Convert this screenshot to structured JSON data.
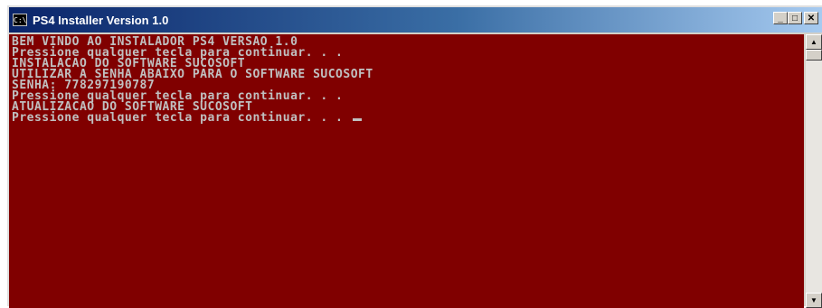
{
  "window": {
    "title": "PS4 Installer Version 1.0",
    "icon_text": "C:\\",
    "buttons": {
      "minimize": "_",
      "maximize": "□",
      "close": "✕"
    }
  },
  "console": {
    "lines": [
      "BEM VINDO AO INSTALADOR PS4 VERSAO 1.0",
      "Pressione qualquer tecla para continuar. . .",
      "INSTALACAO DO SOFTWARE SUCOSOFT",
      "UTILIZAR A SENHA ABAIXO PARA O SOFTWARE SUCOSOFT",
      "SENHA: 778297190787",
      "Pressione qualquer tecla para continuar. . .",
      "ATUALIZACAO DO SOFTWARE SUCOSOFT",
      "Pressione qualquer tecla para continuar. . . "
    ]
  },
  "scrollbar": {
    "up_arrow": "▲",
    "down_arrow": "▼"
  },
  "colors": {
    "console_background": "#800000",
    "console_text": "#c0c0c0",
    "titlebar_start": "#0a246a",
    "titlebar_end": "#a6caf0"
  }
}
